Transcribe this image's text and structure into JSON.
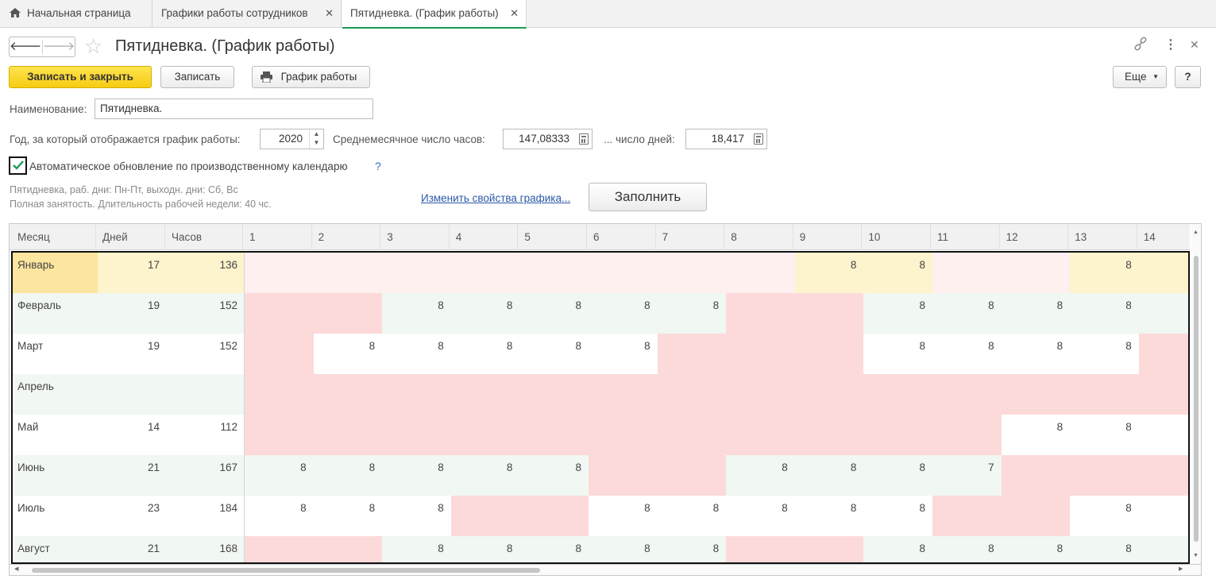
{
  "tabs": [
    {
      "label": "Начальная страница"
    },
    {
      "label": "Графики работы сотрудников"
    },
    {
      "label": "Пятидневка. (График работы)"
    }
  ],
  "title": "Пятидневка. (График работы)",
  "toolbar": {
    "save_close": "Записать и закрыть",
    "save": "Записать",
    "schedule": "График работы",
    "more": "Еще",
    "help": "?"
  },
  "form": {
    "name_label": "Наименование:",
    "name_value": "Пятидневка.",
    "year_label": "Год, за который отображается график работы:",
    "year_value": "2020",
    "avg_hours_label": "Среднемесячное число часов:",
    "avg_hours_value": "147,08333",
    "days_label": "... число дней:",
    "days_value": "18,417",
    "auto_update_label": "Автоматическое обновление по производственному календарю",
    "auto_update_checked": true,
    "help_mark": "?",
    "note_line1": "Пятидневка, раб. дни: Пн-Пт, выходн. дни: Сб, Вс",
    "note_line2": "Полная занятость. Длительность рабочей недели: 40 чс.",
    "change_link": "Изменить свойства графика...",
    "fill_button": "Заполнить"
  },
  "grid": {
    "columns": [
      "Месяц",
      "Дней",
      "Часов",
      "1",
      "2",
      "3",
      "4",
      "5",
      "6",
      "7",
      "8",
      "9",
      "10",
      "11",
      "12",
      "13",
      "14"
    ],
    "colors": {
      "work_odd": "#ffffff",
      "work_even": "#f1f7f2",
      "weekend": "#fcdada",
      "jan_holiday": "#fdf0ef",
      "jan_work": "#fdf3cd",
      "jan_month": "#fce59e"
    },
    "rows": [
      {
        "month": "Январь",
        "days": "17",
        "hours": "136",
        "cells": [
          "",
          "",
          "",
          "",
          "",
          "",
          "",
          "",
          "8",
          "8",
          "",
          "",
          "8",
          ""
        ],
        "types": [
          "h",
          "h",
          "h",
          "h",
          "h",
          "h",
          "h",
          "h",
          "w",
          "w",
          "h",
          "h",
          "w",
          "w"
        ]
      },
      {
        "month": "Февраль",
        "days": "19",
        "hours": "152",
        "cells": [
          "",
          "",
          "8",
          "8",
          "8",
          "8",
          "8",
          "",
          "",
          "8",
          "8",
          "8",
          "8",
          ""
        ],
        "types": [
          "x",
          "x",
          "w",
          "w",
          "w",
          "w",
          "w",
          "x",
          "x",
          "w",
          "w",
          "w",
          "w",
          "w"
        ]
      },
      {
        "month": "Март",
        "days": "19",
        "hours": "152",
        "cells": [
          "",
          "8",
          "8",
          "8",
          "8",
          "8",
          "",
          "",
          "",
          "8",
          "8",
          "8",
          "8",
          ""
        ],
        "types": [
          "x",
          "w",
          "w",
          "w",
          "w",
          "w",
          "x",
          "x",
          "x",
          "w",
          "w",
          "w",
          "w",
          "x"
        ]
      },
      {
        "month": "Апрель",
        "days": "",
        "hours": "",
        "cells": [
          "",
          "",
          "",
          "",
          "",
          "",
          "",
          "",
          "",
          "",
          "",
          "",
          "",
          ""
        ],
        "types": [
          "x",
          "x",
          "x",
          "x",
          "x",
          "x",
          "x",
          "x",
          "x",
          "x",
          "x",
          "x",
          "x",
          "x"
        ]
      },
      {
        "month": "Май",
        "days": "14",
        "hours": "112",
        "cells": [
          "",
          "",
          "",
          "",
          "",
          "",
          "",
          "",
          "",
          "",
          "",
          "8",
          "8",
          ""
        ],
        "types": [
          "x",
          "x",
          "x",
          "x",
          "x",
          "x",
          "x",
          "x",
          "x",
          "x",
          "x",
          "w",
          "w",
          "w"
        ]
      },
      {
        "month": "Июнь",
        "days": "21",
        "hours": "167",
        "cells": [
          "8",
          "8",
          "8",
          "8",
          "8",
          "",
          "",
          "8",
          "8",
          "8",
          "7",
          "",
          "",
          ""
        ],
        "types": [
          "w",
          "w",
          "w",
          "w",
          "w",
          "x",
          "x",
          "w",
          "w",
          "w",
          "w",
          "x",
          "x",
          "x"
        ]
      },
      {
        "month": "Июль",
        "days": "23",
        "hours": "184",
        "cells": [
          "8",
          "8",
          "8",
          "",
          "",
          "8",
          "8",
          "8",
          "8",
          "8",
          "",
          "",
          "8",
          ""
        ],
        "types": [
          "w",
          "w",
          "w",
          "x",
          "x",
          "w",
          "w",
          "w",
          "w",
          "w",
          "x",
          "x",
          "w",
          "w"
        ]
      },
      {
        "month": "Август",
        "days": "21",
        "hours": "168",
        "cells": [
          "",
          "",
          "8",
          "8",
          "8",
          "8",
          "8",
          "",
          "",
          "8",
          "8",
          "8",
          "8",
          ""
        ],
        "types": [
          "x",
          "x",
          "w",
          "w",
          "w",
          "w",
          "w",
          "x",
          "x",
          "w",
          "w",
          "w",
          "w",
          "w"
        ]
      }
    ]
  }
}
